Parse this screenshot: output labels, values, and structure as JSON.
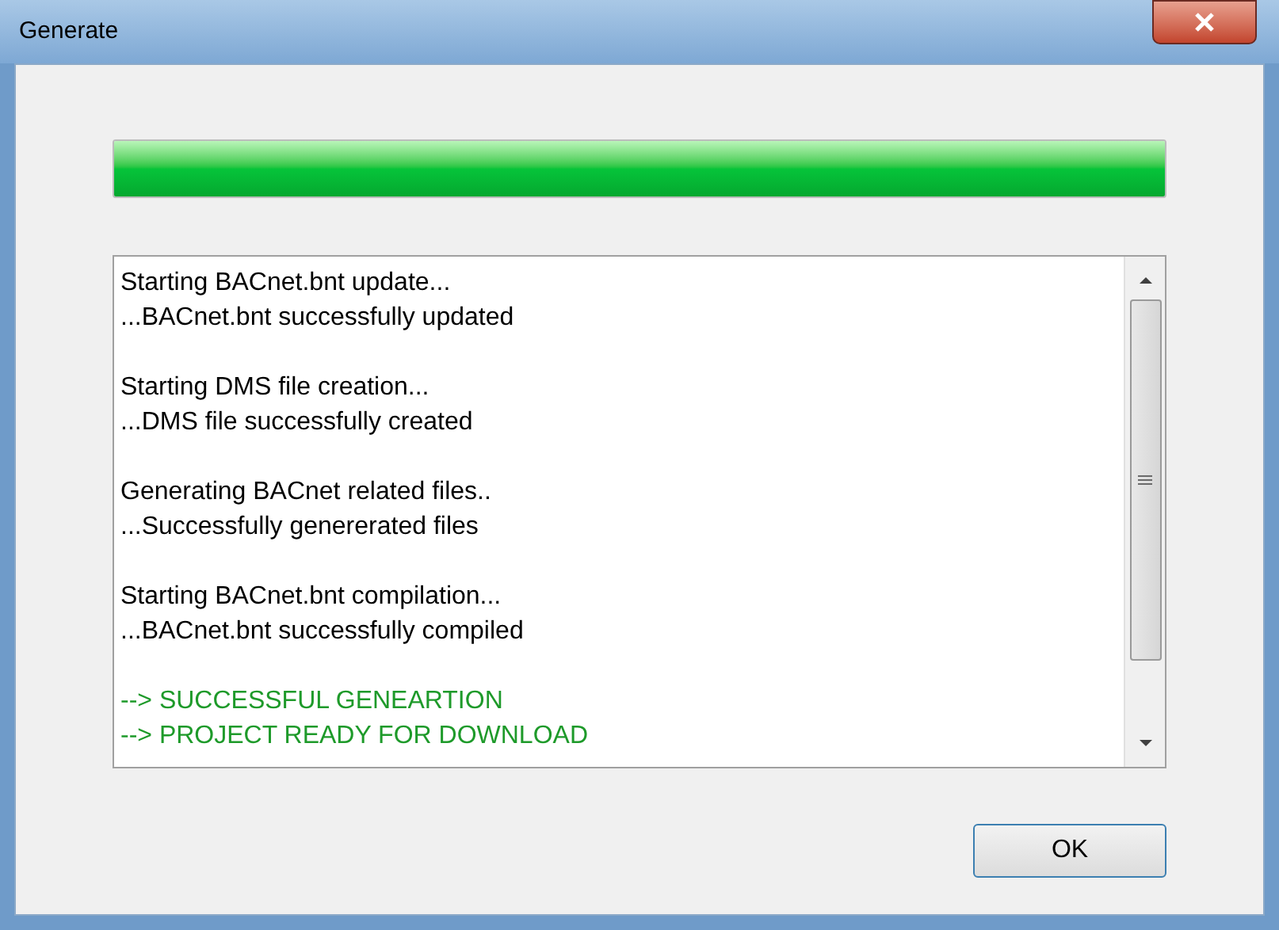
{
  "window": {
    "title": "Generate"
  },
  "progress": {
    "level": 1
  },
  "log": {
    "groups": [
      {
        "kind": "info",
        "lines": [
          "Starting BACnet.bnt update...",
          "...BACnet.bnt successfully updated"
        ]
      },
      {
        "kind": "info",
        "lines": [
          "Starting DMS file creation...",
          "...DMS file successfully created"
        ]
      },
      {
        "kind": "info",
        "lines": [
          "Generating BACnet related files..",
          "...Successfully genererated files"
        ]
      },
      {
        "kind": "info",
        "lines": [
          "Starting BACnet.bnt compilation...",
          "...BACnet.bnt successfully compiled"
        ]
      },
      {
        "kind": "success",
        "lines": [
          "--> SUCCESSFUL GENEARTION",
          "--> PROJECT READY FOR DOWNLOAD"
        ]
      }
    ]
  },
  "buttons": [
    "OK"
  ]
}
